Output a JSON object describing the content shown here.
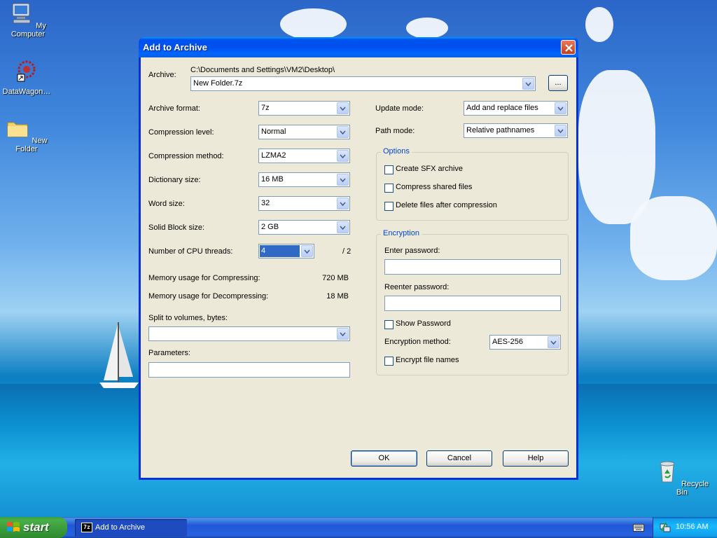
{
  "desktop": {
    "icons": [
      {
        "label": "My Computer"
      },
      {
        "label": "DataWagon…"
      },
      {
        "label": "New Folder"
      },
      {
        "label": "Recycle Bin"
      }
    ]
  },
  "dialog": {
    "title": "Add to Archive",
    "archive_label": "Archive:",
    "archive_path": "C:\\Documents and Settings\\VM2\\Desktop\\",
    "archive_name": "New Folder.7z",
    "browse_label": "...",
    "left": {
      "archive_format": {
        "label": "Archive format:",
        "value": "7z"
      },
      "compression_level": {
        "label": "Compression level:",
        "value": "Normal"
      },
      "compression_method": {
        "label": "Compression method:",
        "value": "LZMA2"
      },
      "dictionary_size": {
        "label": "Dictionary size:",
        "value": "16 MB"
      },
      "word_size": {
        "label": "Word size:",
        "value": "32"
      },
      "solid_block_size": {
        "label": "Solid Block size:",
        "value": "2 GB"
      },
      "cpu_threads": {
        "label": "Number of CPU threads:",
        "value": "4",
        "max": "/ 2"
      },
      "mem_compress": {
        "label": "Memory usage for Compressing:",
        "value": "720 MB"
      },
      "mem_decompress": {
        "label": "Memory usage for Decompressing:",
        "value": "18 MB"
      },
      "split_volumes": {
        "label": "Split to volumes, bytes:",
        "value": ""
      },
      "parameters": {
        "label": "Parameters:",
        "value": ""
      }
    },
    "right": {
      "update_mode": {
        "label": "Update mode:",
        "value": "Add and replace files"
      },
      "path_mode": {
        "label": "Path mode:",
        "value": "Relative pathnames"
      },
      "options": {
        "legend": "Options",
        "create_sfx": "Create SFX archive",
        "compress_shared": "Compress shared files",
        "delete_after": "Delete files after compression"
      },
      "encryption": {
        "legend": "Encryption",
        "enter_password": "Enter password:",
        "reenter_password": "Reenter password:",
        "show_password": "Show Password",
        "method_label": "Encryption method:",
        "method_value": "AES-256",
        "encrypt_names": "Encrypt file names"
      }
    },
    "buttons": {
      "ok": "OK",
      "cancel": "Cancel",
      "help": "Help"
    }
  },
  "taskbar": {
    "start": "start",
    "task_label": "Add to Archive",
    "task_icon_text": "7z",
    "clock": "10:56 AM"
  }
}
